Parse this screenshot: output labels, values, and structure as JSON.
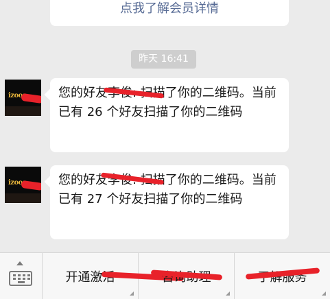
{
  "header_card": {
    "link_text": "点我了解会员详情"
  },
  "timestamp": "昨天 16:41",
  "messages": [
    {
      "avatar_brand": "izoos",
      "prefix": "您的好友",
      "name_masked": "李俊",
      "body": ": 扫描了你的二维码。当前已有 26 个好友扫描了你的二维码"
    },
    {
      "avatar_brand": "izoos",
      "prefix": "您的好友",
      "name_masked": "李俊",
      "body": ": 扫描了你的二维码。当前已有 27 个好友扫描了你的二维码"
    }
  ],
  "menu": {
    "keyboard_icon": "keyboard-icon",
    "items": [
      {
        "label": "开通激活"
      },
      {
        "label": "咨询助理"
      },
      {
        "label": "了解服务"
      }
    ]
  },
  "colors": {
    "background": "#ebebeb",
    "bubble": "#ffffff",
    "link": "#576b95",
    "redaction": "#e8222a",
    "time_badge": "#cecece"
  }
}
